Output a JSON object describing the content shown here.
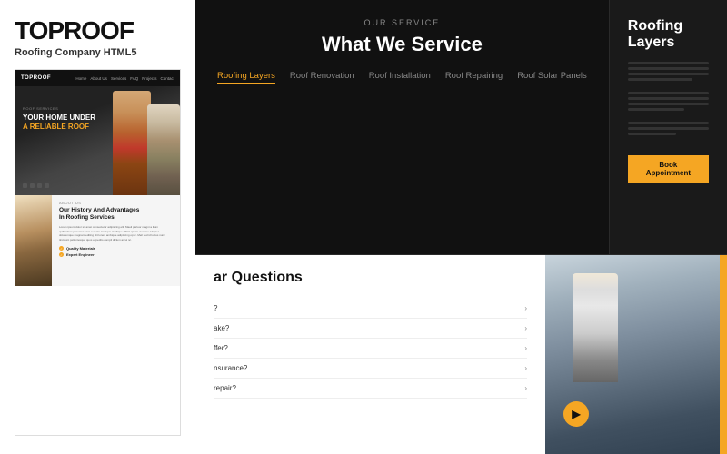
{
  "brand": {
    "title": "TOPROOF",
    "subtitle": "Roofing Company HTML5"
  },
  "mockup": {
    "nav": {
      "brand": "TOPROOF",
      "links": [
        "Home",
        "About Us",
        "Services",
        "FAQ",
        "Projects",
        "Contact"
      ]
    },
    "hero": {
      "roof_services": "ROOF SERVICES",
      "headline_line1": "YOUR HOME UNDER",
      "headline_line2": "A RELIABLE ROOF"
    },
    "about": {
      "label": "ABOUT US",
      "title": "Our History And Advantages\nIn Roofing Services",
      "description": "Lorem ipsum dolor sit amet consectetur adipiscing elit. Maeli partuor magni a illum quillundum posumus eros a seras ambique similique officia ipsum ut nemo adapter doloremque magnam editing elit lorem ambique similique adipiscing optic. Meil sed id luctus nunc tincidunt pellentesque quos, expedite, compli dictum arcui nc.",
      "feature1": "Quality Materials",
      "feature2": "Expert Engineer"
    }
  },
  "right": {
    "service": {
      "our_service_label": "OUR SERVICE",
      "title": "What We Service",
      "tabs": [
        {
          "label": "Roofing Layers",
          "active": true
        },
        {
          "label": "Roof Renovation",
          "active": false
        },
        {
          "label": "Roof Installation",
          "active": false
        },
        {
          "label": "Roof Repairing",
          "active": false
        },
        {
          "label": "Roof Solar Panels",
          "active": false
        }
      ]
    },
    "roofing_layers": {
      "title": "Roofing Layers",
      "description1": "Lorem ipsum dolor sit amet consectetur adipiscing elit. Maecblibo, a iltos Performantics, accumsantut adipi does netus aut. moplenta educationtur elam. at ullam volunt labore et.",
      "description2": "Lorem ipsum dolor sit amet consectetur adipiscing elit. Maecblibo, a iltos Performantics, accumsantut adipi does netus aut. moplenta educationtur elam. at ullam volunt labore et.",
      "description3": "Lorem ipsum dolor sit amet consectetur adipiscing elit. Maecblibo, a iltos Performantics, accumsantut adipi does netus aut. moplenta educationtur elam. at ullam volunt labore et.",
      "book_btn": "Book Appointment"
    },
    "faq": {
      "title": "ar Questions",
      "questions": [
        "?",
        "ake?",
        "ffer?",
        "nsurance?",
        "repair?"
      ]
    }
  },
  "colors": {
    "yellow": "#f5a623",
    "dark": "#111111",
    "mid_dark": "#1a1a1a",
    "white": "#ffffff"
  }
}
